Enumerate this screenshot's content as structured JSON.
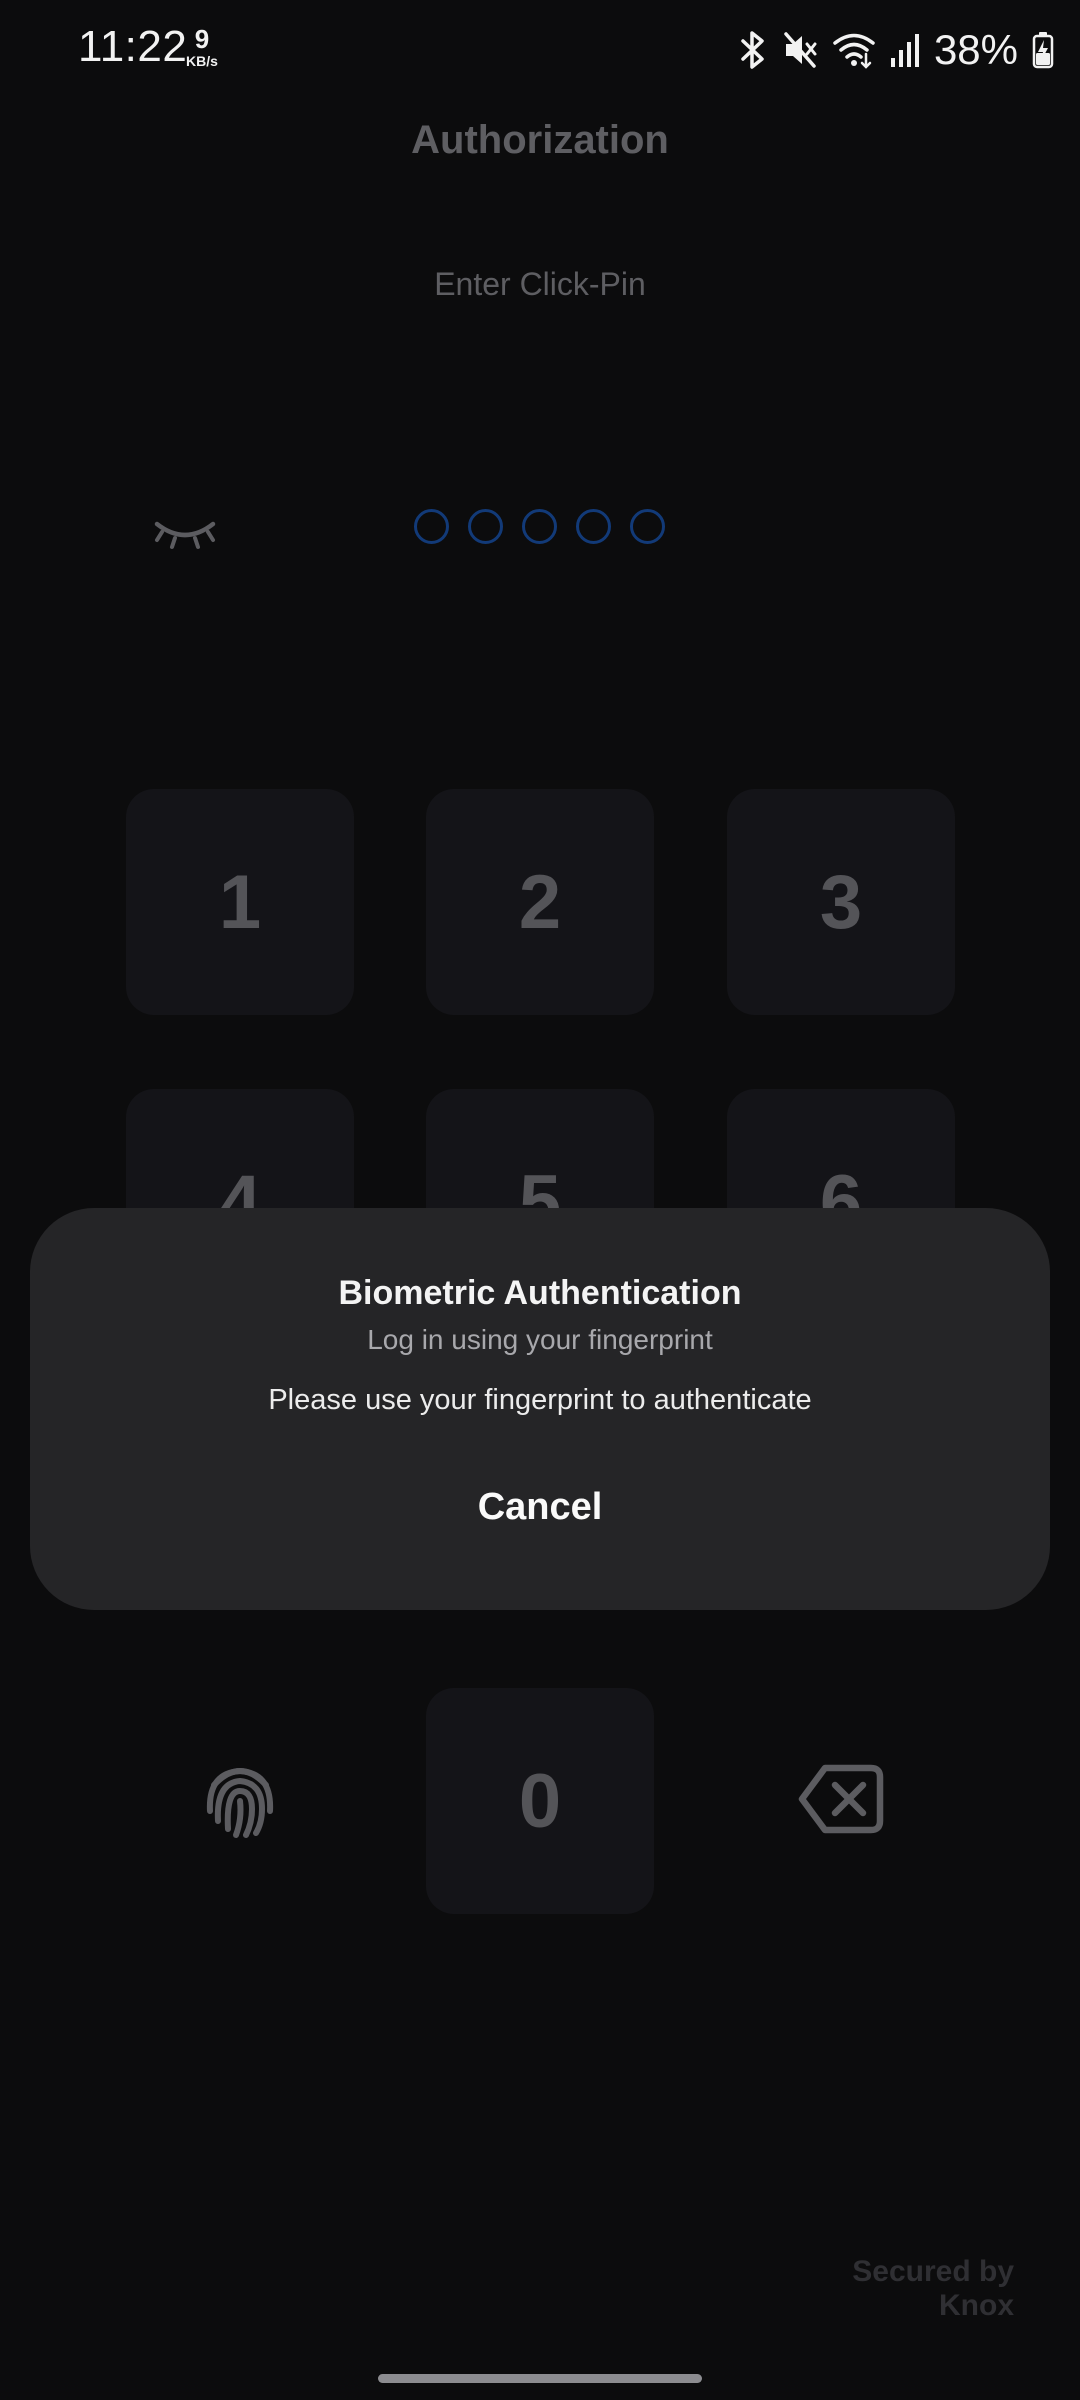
{
  "status_bar": {
    "time": "11:22",
    "net_speed_value": "9",
    "net_speed_unit": "KB/s",
    "icons": [
      "bluetooth-icon",
      "mute-icon",
      "wifi-icon",
      "signal-icon",
      "battery-charging-icon"
    ],
    "battery_percent": "38%"
  },
  "header": {
    "title": "Authorization",
    "prompt": "Enter Click-Pin"
  },
  "pin": {
    "length": 5,
    "entered": 0,
    "toggle_icon": "eye-closed-icon"
  },
  "keypad": {
    "keys": [
      "1",
      "2",
      "3",
      "4",
      "5",
      "6",
      "0"
    ],
    "left_action_icon": "fingerprint-icon",
    "right_action_icon": "backspace-icon"
  },
  "dialog": {
    "title": "Biometric Authentication",
    "subtitle": "Log in using your fingerprint",
    "description": "Please use your fingerprint to authenticate",
    "cancel_label": "Cancel"
  },
  "footer": {
    "knox_line1": "Secured by",
    "knox_line2": "Knox"
  },
  "colors": {
    "background": "#0c0c0d",
    "key_background": "#141418",
    "key_text": "#545458",
    "pin_dot_outline": "#123a78",
    "dialog_background": "#252527"
  }
}
